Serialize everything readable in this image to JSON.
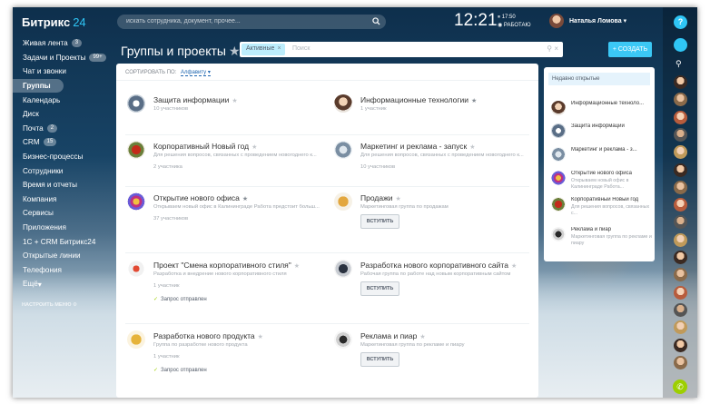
{
  "logo": {
    "name": "Битрикс",
    "num": "24"
  },
  "menu": [
    {
      "label": "Живая лента",
      "badge": "3"
    },
    {
      "label": "Задачи и Проекты",
      "badge": "99+"
    },
    {
      "label": "Чат и звонки",
      "badge": ""
    },
    {
      "label": "Группы",
      "badge": "",
      "active": true
    },
    {
      "label": "Календарь",
      "badge": ""
    },
    {
      "label": "Диск",
      "badge": ""
    },
    {
      "label": "Почта",
      "badge": "2"
    },
    {
      "label": "CRM",
      "badge": "15"
    },
    {
      "label": "Бизнес-процессы",
      "badge": ""
    },
    {
      "label": "Сотрудники",
      "badge": ""
    },
    {
      "label": "Время и отчеты",
      "badge": ""
    },
    {
      "label": "Компания",
      "badge": ""
    },
    {
      "label": "Сервисы",
      "badge": ""
    },
    {
      "label": "Приложения",
      "badge": ""
    },
    {
      "label": "1С + CRM Битрикс24",
      "badge": ""
    },
    {
      "label": "Открытые линии",
      "badge": ""
    },
    {
      "label": "Телефония",
      "badge": ""
    },
    {
      "label": "Ещё",
      "badge": "",
      "chevron": "▾"
    }
  ],
  "menu_settings": "НАСТРОИТЬ МЕНЮ",
  "header": {
    "search_placeholder": "искать сотрудника, документ, прочее...",
    "time": "12:21",
    "work_time": "17:50",
    "work_status": "РАБОТАЮ",
    "user_name": "Наталья Ломова"
  },
  "page": {
    "title": "Группы и проекты",
    "filter_chip": "Активные",
    "filter_placeholder": "Поиск",
    "create_label": "+ СОЗДАТЬ",
    "sort_label": "СОРТИРОВАТЬ ПО:",
    "sort_value": "Алфавиту"
  },
  "groups": [
    {
      "name": "Защита информации",
      "desc": "",
      "members": "10 участников",
      "starred": false,
      "thumb": "t-info"
    },
    {
      "name": "Информационные технологии",
      "desc": "",
      "members": "1 участник",
      "starred": true,
      "thumb": "t-it"
    },
    {
      "name": "Корпоративный Новый год",
      "desc": "Для решения вопросов, связанных с проведением новогоднего к...",
      "members": "2 участника",
      "starred": false,
      "thumb": "t-ny"
    },
    {
      "name": "Маркетинг и реклама - запуск",
      "desc": "Для решения вопросов, связанных с проведением новогоднего к...",
      "members": "10 участников",
      "starred": false,
      "thumb": "t-mk"
    },
    {
      "name": "Открытие нового офиса",
      "desc": "Открываем новый офис в Калининграде Работа предстоит больш...",
      "members": "37 участников",
      "starred": true,
      "thumb": "t-off"
    },
    {
      "name": "Продажи",
      "desc": "Маркетинговая группа по продажам",
      "members": "",
      "starred": false,
      "thumb": "t-sale",
      "join": "ВСТУПИТЬ"
    },
    {
      "name": "Проект \"Смена корпоративного стиля\"",
      "desc": "Разработка и внедрение нового корпоративного стиля",
      "members": "1 участник",
      "starred": false,
      "thumb": "t-proj",
      "request": "Запрос отправлен"
    },
    {
      "name": "Разработка нового корпоративного сайта",
      "desc": "Рабочая группа по работе над новым корпоративным сайтом",
      "members": "",
      "starred": false,
      "thumb": "t-site",
      "join": "ВСТУПИТЬ"
    },
    {
      "name": "Разработка нового продукта",
      "desc": "Группа по разработке нового продукта",
      "members": "1 участник",
      "starred": false,
      "thumb": "t-prod",
      "request": "Запрос отправлен"
    },
    {
      "name": "Реклама и пиар",
      "desc": "Маркетинговая группа по рекламе и пиару",
      "members": "",
      "starred": false,
      "thumb": "t-pr",
      "join": "ВСТУПИТЬ"
    }
  ],
  "recent": {
    "title": "Недавно открытые",
    "items": [
      {
        "name": "Информационные техноло...",
        "desc": "",
        "thumb": "t-it"
      },
      {
        "name": "Защита информации",
        "desc": "",
        "thumb": "t-info"
      },
      {
        "name": "Маркетинг и реклама - з...",
        "desc": "",
        "thumb": "t-mk"
      },
      {
        "name": "Открытие нового офиса",
        "desc": "Открываем новый офис в Калининграде Работа...",
        "thumb": "t-off"
      },
      {
        "name": "Корпоративный Новый год",
        "desc": "Для решения вопросов, связанных с...",
        "thumb": "t-ny"
      },
      {
        "name": "Реклама и пиар",
        "desc": "Маркетинговая группа по рекламе и пиару",
        "thumb": "t-pr"
      }
    ]
  },
  "icons": {
    "search": "search-icon",
    "star": "star-icon",
    "bell": "bell-icon",
    "help": "help-icon",
    "phone": "phone-icon"
  },
  "colors": {
    "accent": "#3bc8f5",
    "active_menu": "rgba(255,255,255,.28)",
    "success": "#9dcf00"
  }
}
